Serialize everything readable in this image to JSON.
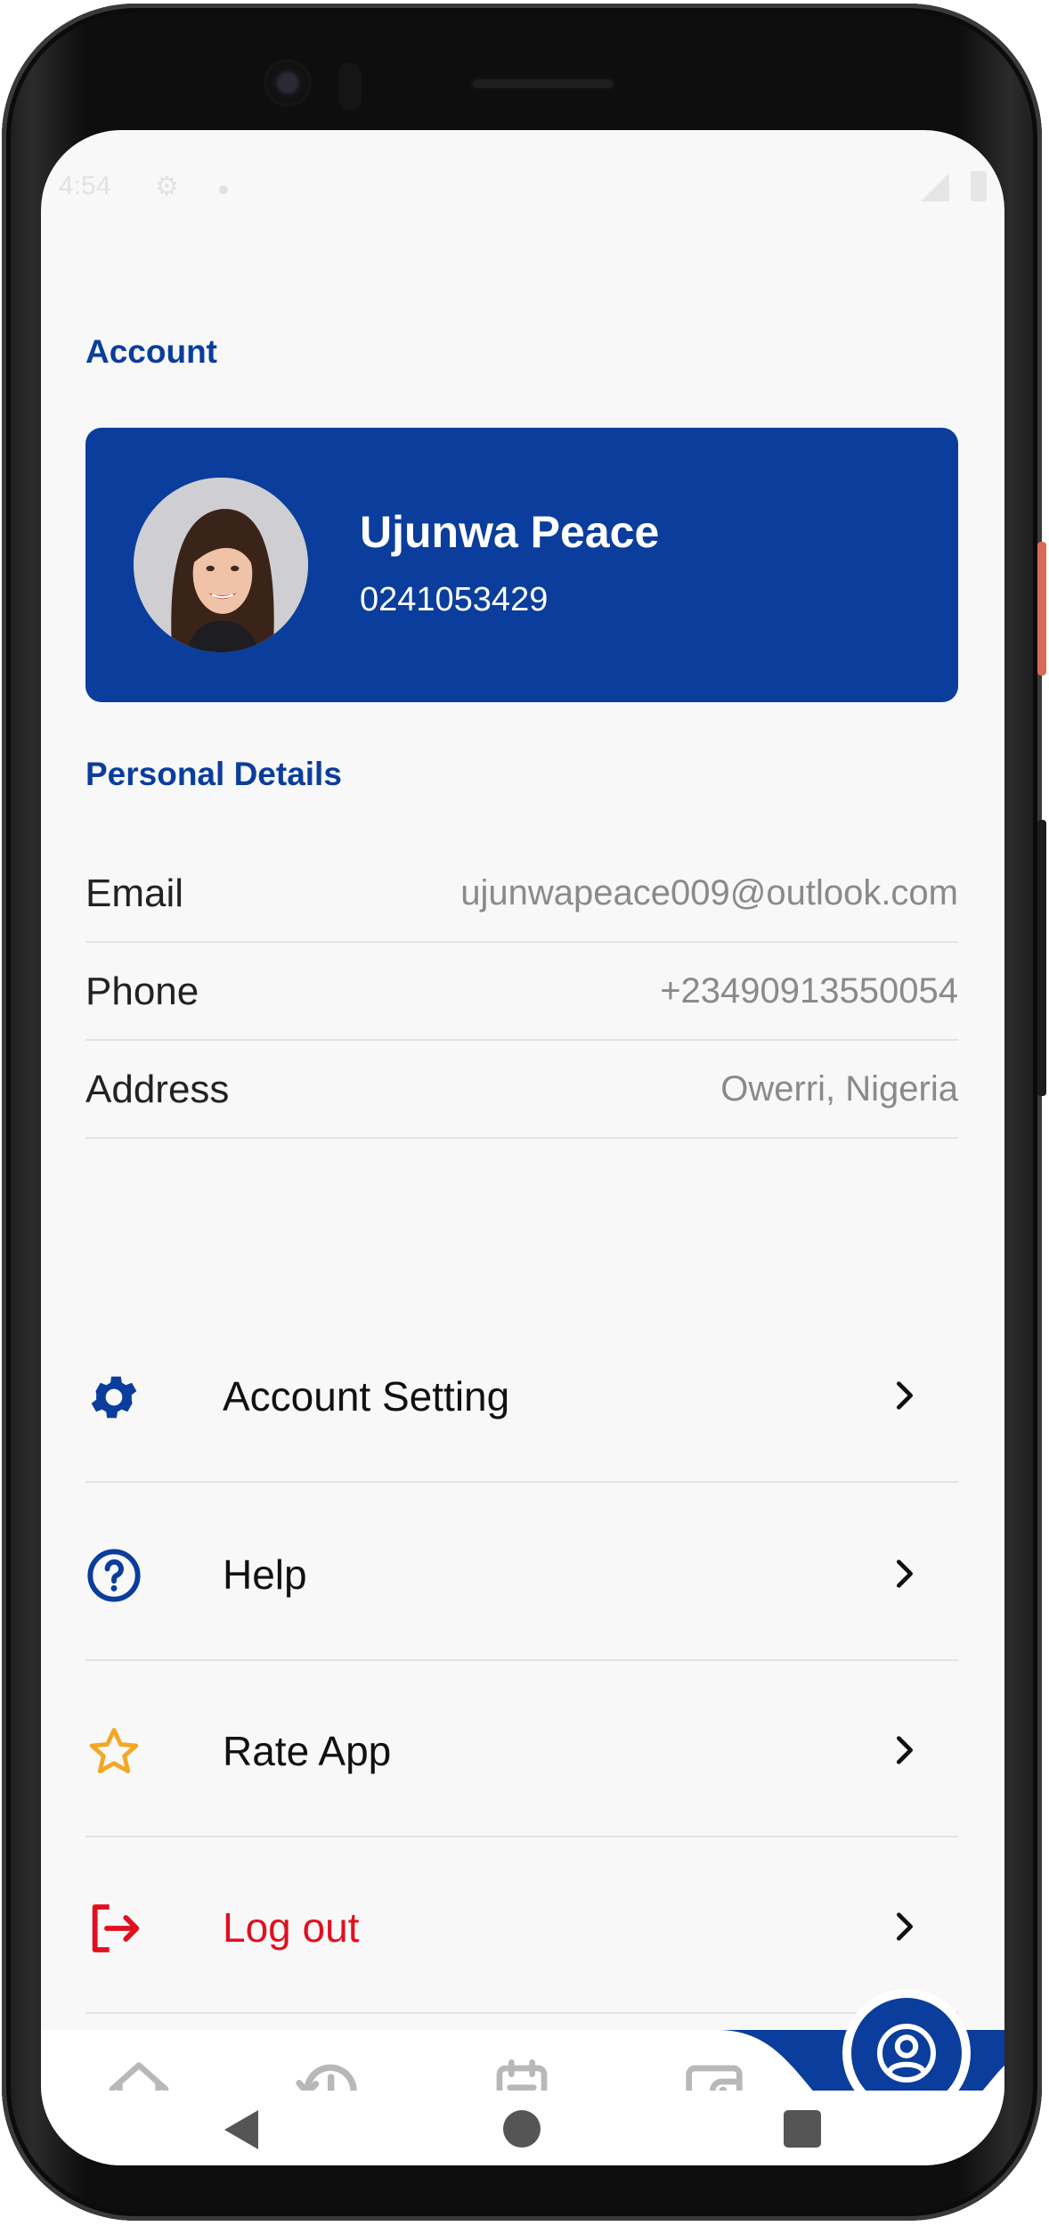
{
  "status_bar": {
    "time": "4:54"
  },
  "account": {
    "section_title": "Account",
    "name": "Ujunwa Peace",
    "phone": "0241053429"
  },
  "personal_details": {
    "section_title": "Personal Details",
    "rows": [
      {
        "label": "Email",
        "value": "ujunwapeace009@outlook.com"
      },
      {
        "label": "Phone",
        "value": "+23490913550054"
      },
      {
        "label": "Address",
        "value": "Owerri, Nigeria"
      }
    ]
  },
  "menu": [
    {
      "label": "Account Setting",
      "icon": "gear-icon",
      "color": "#0a3d9c"
    },
    {
      "label": "Help",
      "icon": "question-circle-icon",
      "color": "#0a3d9c"
    },
    {
      "label": "Rate App",
      "icon": "star-icon",
      "color": "#f5a623"
    },
    {
      "label": "Log out",
      "icon": "logout-icon",
      "color": "#e0101f"
    }
  ],
  "bottom_nav": {
    "items": [
      "home-icon",
      "history-icon",
      "orders-icon",
      "wallet-icon",
      "profile-icon"
    ],
    "active": "profile-icon"
  },
  "colors": {
    "primary": "#0a3d9c",
    "danger": "#e0101f",
    "star": "#f5a623",
    "inactive_nav": "#b8b8b8"
  }
}
